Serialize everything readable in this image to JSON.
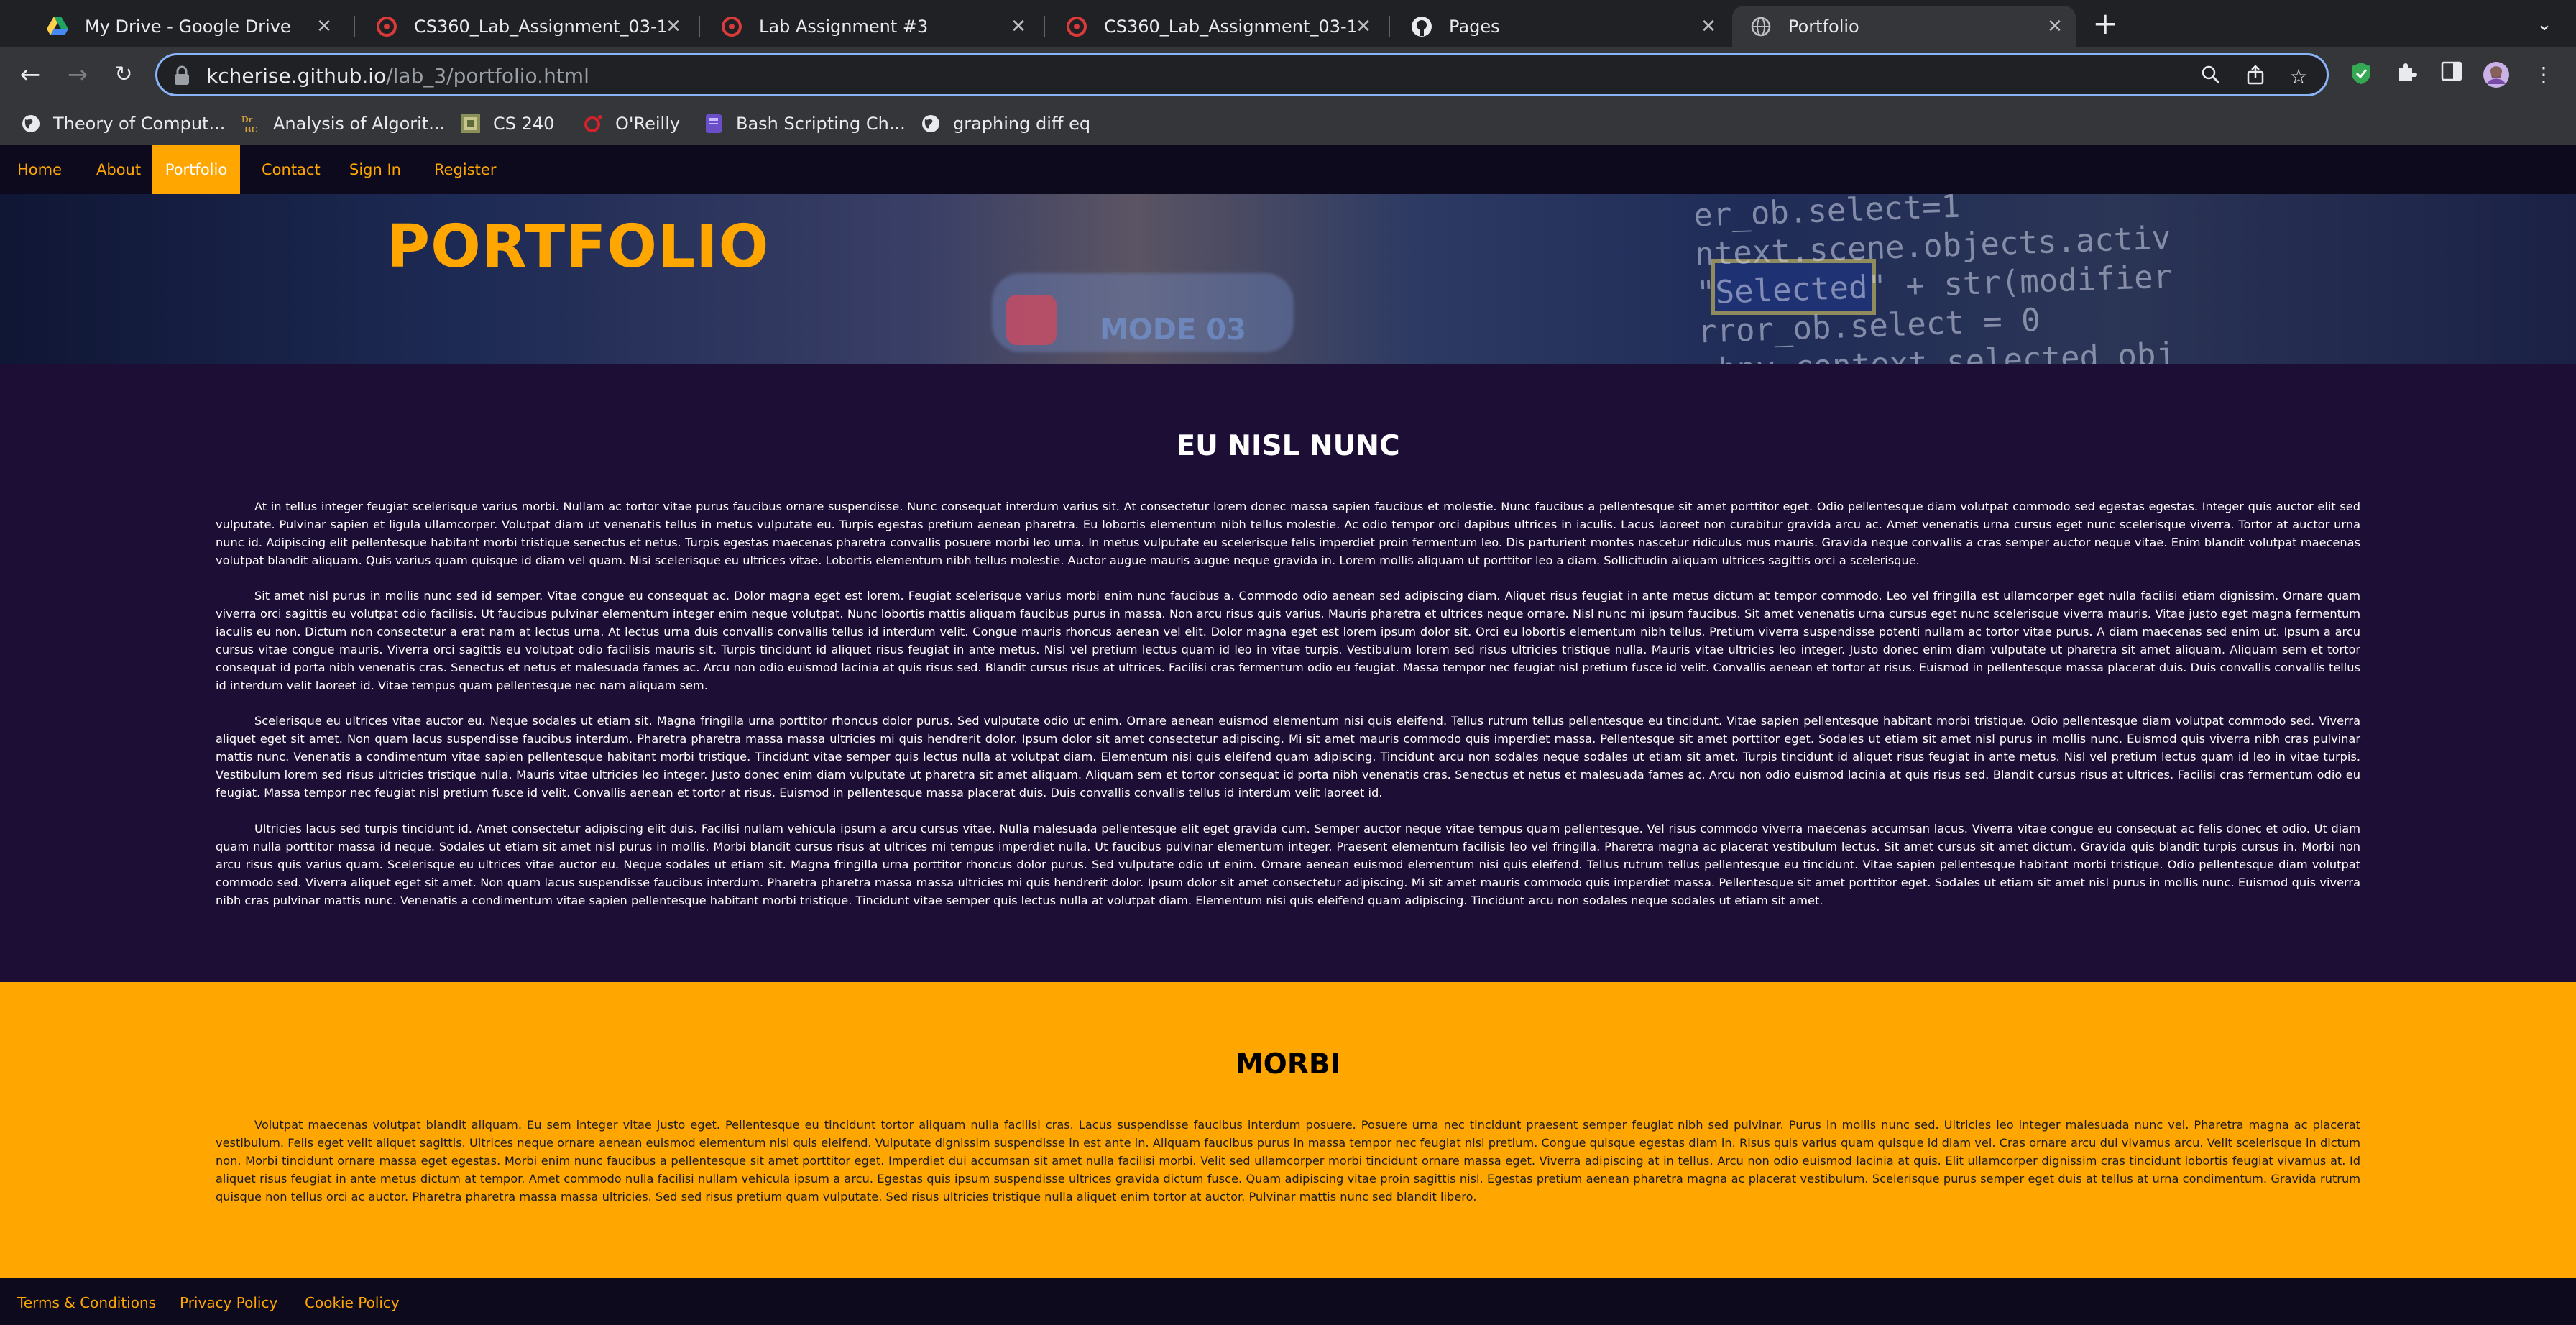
{
  "browser": {
    "tabs": [
      {
        "title": "My Drive - Google Drive",
        "icon": "google-drive-icon"
      },
      {
        "title": "CS360_Lab_Assignment_03-1",
        "icon": "university-logo-icon"
      },
      {
        "title": "Lab Assignment #3",
        "icon": "university-logo-icon"
      },
      {
        "title": "CS360_Lab_Assignment_03-1",
        "icon": "university-logo-icon"
      },
      {
        "title": "Pages",
        "icon": "github-icon"
      },
      {
        "title": "Portfolio",
        "icon": "globe-icon",
        "active": true
      }
    ],
    "url_host": "kcherise.github.io",
    "url_path": "/lab_3/portfolio.html",
    "bookmarks": [
      {
        "label": "Theory of Comput...",
        "icon": "globe-icon"
      },
      {
        "label": "Analysis of Algorit...",
        "icon": "dr-bc-icon"
      },
      {
        "label": "CS 240",
        "icon": "cs240-icon"
      },
      {
        "label": "O'Reilly",
        "icon": "oreilly-icon"
      },
      {
        "label": "Bash Scripting Ch...",
        "icon": "bash-icon"
      },
      {
        "label": "graphing diff eq",
        "icon": "globe-icon"
      }
    ]
  },
  "site": {
    "nav": [
      "Home",
      "About",
      "Portfolio",
      "Contact",
      "Sign In",
      "Register"
    ],
    "active_nav": "Portfolio",
    "hero_title": "PORTFOLIO",
    "sections": [
      {
        "title": "EU NISL NUNC",
        "paragraphs": [
          "At in tellus integer feugiat scelerisque varius morbi. Nullam ac tortor vitae purus faucibus ornare suspendisse. Nunc consequat interdum varius sit. At consectetur lorem donec massa sapien faucibus et molestie. Nunc faucibus a pellentesque sit amet porttitor eget. Odio pellentesque diam volutpat commodo sed egestas egestas. Integer quis auctor elit sed vulputate. Pulvinar sapien et ligula ullamcorper. Volutpat diam ut venenatis tellus in metus vulputate eu. Turpis egestas pretium aenean pharetra. Eu lobortis elementum nibh tellus molestie. Ac odio tempor orci dapibus ultrices in iaculis. Lacus laoreet non curabitur gravida arcu ac. Amet venenatis urna cursus eget nunc scelerisque viverra. Tortor at auctor urna nunc id. Adipiscing elit pellentesque habitant morbi tristique senectus et netus. Turpis egestas maecenas pharetra convallis posuere morbi leo urna. In metus vulputate eu scelerisque felis imperdiet proin fermentum leo. Dis parturient montes nascetur ridiculus mus mauris. Gravida neque convallis a cras semper auctor neque vitae. Enim blandit volutpat maecenas volutpat blandit aliquam. Quis varius quam quisque id diam vel quam. Nisi scelerisque eu ultrices vitae. Lobortis elementum nibh tellus molestie. Auctor augue mauris augue neque gravida in. Lorem mollis aliquam ut porttitor leo a diam. Sollicitudin aliquam ultrices sagittis orci a scelerisque.",
          "Sit amet nisl purus in mollis nunc sed id semper. Vitae congue eu consequat ac. Dolor magna eget est lorem. Feugiat scelerisque varius morbi enim nunc faucibus a. Commodo odio aenean sed adipiscing diam. Aliquet risus feugiat in ante metus dictum at tempor commodo. Leo vel fringilla est ullamcorper eget nulla facilisi etiam dignissim. Ornare quam viverra orci sagittis eu volutpat odio facilisis. Ut faucibus pulvinar elementum integer enim neque volutpat. Nunc lobortis mattis aliquam faucibus purus in massa. Non arcu risus quis varius. Mauris pharetra et ultrices neque ornare. Nisl nunc mi ipsum faucibus. Sit amet venenatis urna cursus eget nunc scelerisque viverra mauris. Vitae justo eget magna fermentum iaculis eu non. Dictum non consectetur a erat nam at lectus urna. At lectus urna duis convallis convallis tellus id interdum velit. Congue mauris rhoncus aenean vel elit. Dolor magna eget est lorem ipsum dolor sit. Orci eu lobortis elementum nibh tellus. Pretium viverra suspendisse potenti nullam ac tortor vitae purus. A diam maecenas sed enim ut. Ipsum a arcu cursus vitae congue mauris. Viverra orci sagittis eu volutpat odio facilisis mauris sit. Turpis tincidunt id aliquet risus feugiat in ante metus. Nisl vel pretium lectus quam id leo in vitae turpis. Vestibulum lorem sed risus ultricies tristique nulla. Mauris vitae ultricies leo integer. Justo donec enim diam vulputate ut pharetra sit amet aliquam. Aliquam sem et tortor consequat id porta nibh venenatis cras. Senectus et netus et malesuada fames ac. Arcu non odio euismod lacinia at quis risus sed. Blandit cursus risus at ultrices. Facilisi cras fermentum odio eu feugiat. Massa tempor nec feugiat nisl pretium fusce id velit. Convallis aenean et tortor at risus. Euismod in pellentesque massa placerat duis. Duis convallis convallis tellus id interdum velit laoreet id. Vitae tempus quam pellentesque nec nam aliquam sem.",
          "Scelerisque eu ultrices vitae auctor eu. Neque sodales ut etiam sit. Magna fringilla urna porttitor rhoncus dolor purus. Sed vulputate odio ut enim. Ornare aenean euismod elementum nisi quis eleifend. Tellus rutrum tellus pellentesque eu tincidunt. Vitae sapien pellentesque habitant morbi tristique. Odio pellentesque diam volutpat commodo sed. Viverra aliquet eget sit amet. Non quam lacus suspendisse faucibus interdum. Pharetra pharetra massa massa ultricies mi quis hendrerit dolor. Ipsum dolor sit amet consectetur adipiscing. Mi sit amet mauris commodo quis imperdiet massa. Pellentesque sit amet porttitor eget. Sodales ut etiam sit amet nisl purus in mollis nunc. Euismod quis viverra nibh cras pulvinar mattis nunc. Venenatis a condimentum vitae sapien pellentesque habitant morbi tristique. Tincidunt vitae semper quis lectus nulla at volutpat diam. Elementum nisi quis eleifend quam adipiscing. Tincidunt arcu non sodales neque sodales ut etiam sit amet. Turpis tincidunt id aliquet risus feugiat in ante metus. Nisl vel pretium lectus quam id leo in vitae turpis. Vestibulum lorem sed risus ultricies tristique nulla. Mauris vitae ultricies leo integer. Justo donec enim diam vulputate ut pharetra sit amet aliquam. Aliquam sem et tortor consequat id porta nibh venenatis cras. Senectus et netus et malesuada fames ac. Arcu non odio euismod lacinia at quis risus sed. Blandit cursus risus at ultrices. Facilisi cras fermentum odio eu feugiat. Massa tempor nec feugiat nisl pretium fusce id velit. Convallis aenean et tortor at risus. Euismod in pellentesque massa placerat duis. Duis convallis convallis tellus id interdum velit laoreet id.",
          "Ultricies lacus sed turpis tincidunt id. Amet consectetur adipiscing elit duis. Facilisi nullam vehicula ipsum a arcu cursus vitae. Nulla malesuada pellentesque elit eget gravida cum. Semper auctor neque vitae tempus quam pellentesque. Vel risus commodo viverra maecenas accumsan lacus. Viverra vitae congue eu consequat ac felis donec et odio. Ut diam quam nulla porttitor massa id neque. Sodales ut etiam sit amet nisl purus in mollis. Morbi blandit cursus risus at ultrices mi tempus imperdiet nulla. Ut faucibus pulvinar elementum integer. Praesent elementum facilisis leo vel fringilla. Pharetra magna ac placerat vestibulum lectus. Sit amet cursus sit amet dictum. Gravida quis blandit turpis cursus in. Morbi non arcu risus quis varius quam. Scelerisque eu ultrices vitae auctor eu. Neque sodales ut etiam sit. Magna fringilla urna porttitor rhoncus dolor purus. Sed vulputate odio ut enim. Ornare aenean euismod elementum nisi quis eleifend. Tellus rutrum tellus pellentesque eu tincidunt. Vitae sapien pellentesque habitant morbi tristique. Odio pellentesque diam volutpat commodo sed. Viverra aliquet eget sit amet. Non quam lacus suspendisse faucibus interdum. Pharetra pharetra massa massa ultricies mi quis hendrerit dolor. Ipsum dolor sit amet consectetur adipiscing. Mi sit amet mauris commodo quis imperdiet massa. Pellentesque sit amet porttitor eget. Sodales ut etiam sit amet nisl purus in mollis nunc. Euismod quis viverra nibh cras pulvinar mattis nunc. Venenatis a condimentum vitae sapien pellentesque habitant morbi tristique. Tincidunt vitae semper quis lectus nulla at volutpat diam. Elementum nisi quis eleifend quam adipiscing. Tincidunt arcu non sodales neque sodales ut etiam sit amet."
        ]
      },
      {
        "title": "MORBI",
        "paragraphs": [
          "Volutpat maecenas volutpat blandit aliquam. Eu sem integer vitae justo eget. Pellentesque eu tincidunt tortor aliquam nulla facilisi cras. Lacus suspendisse faucibus interdum posuere. Posuere urna nec tincidunt praesent semper feugiat nibh sed pulvinar. Purus in mollis nunc sed. Ultricies leo integer malesuada nunc vel. Pharetra magna ac placerat vestibulum. Felis eget velit aliquet sagittis. Ultrices neque ornare aenean euismod elementum nisi quis eleifend. Vulputate dignissim suspendisse in est ante in. Aliquam faucibus purus in massa tempor nec feugiat nisl pretium. Congue quisque egestas diam in. Risus quis varius quam quisque id diam vel. Cras ornare arcu dui vivamus arcu. Velit scelerisque in dictum non. Morbi tincidunt ornare massa eget egestas. Morbi enim nunc faucibus a pellentesque sit amet porttitor eget. Imperdiet dui accumsan sit amet nulla facilisi morbi. Velit sed ullamcorper morbi tincidunt ornare massa eget. Viverra adipiscing at in tellus. Arcu non odio euismod lacinia at quis. Elit ullamcorper dignissim cras tincidunt lobortis feugiat vivamus at. Id aliquet risus feugiat in ante metus dictum at tempor. Amet commodo nulla facilisi nullam vehicula ipsum a arcu. Egestas quis ipsum suspendisse ultrices gravida dictum fusce. Quam adipiscing vitae proin sagittis nisl. Egestas pretium aenean pharetra magna ac placerat vestibulum. Scelerisque purus semper eget duis at tellus at urna condimentum. Gravida rutrum quisque non tellus orci ac auctor. Pharetra pharetra massa massa ultricies. Sed sed risus pretium quam vulputate. Sed risus ultricies tristique nulla aliquet enim tortor at auctor. Pulvinar mattis nunc sed blandit libero."
        ]
      }
    ],
    "footer": [
      "Terms & Conditions",
      "Privacy Policy",
      "Cookie Policy"
    ]
  },
  "colors": {
    "accent": "#ffa600",
    "nav_bg": "#0d0a1e",
    "section_dark": "#1d0e35",
    "section_light": "#ffa600",
    "omnibox_focus": "#8ab4f8"
  }
}
